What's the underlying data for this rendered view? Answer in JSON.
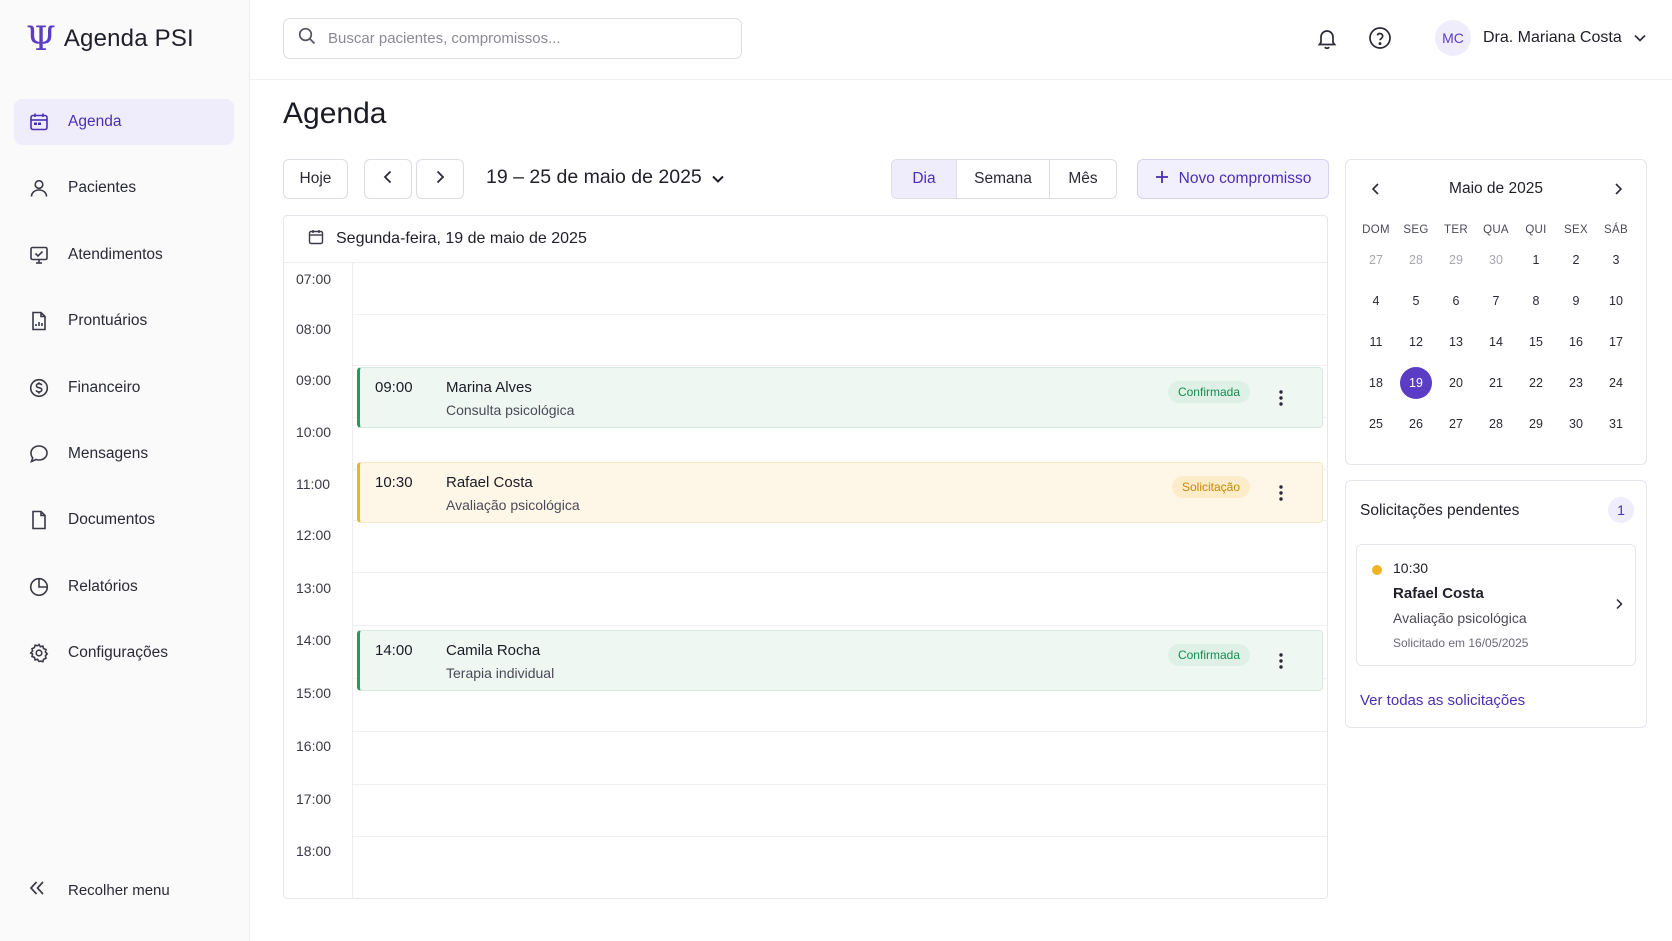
{
  "app": {
    "name": "Agenda PSI",
    "logo_glyph": "Ψ",
    "accent": "#5b3cc4"
  },
  "sidebar": {
    "items": [
      {
        "label": "Agenda",
        "icon": "calendar-icon",
        "active": true
      },
      {
        "label": "Pacientes",
        "icon": "user-icon"
      },
      {
        "label": "Atendimentos",
        "icon": "monitor-check-icon"
      },
      {
        "label": "Prontuários",
        "icon": "file-chart-icon"
      },
      {
        "label": "Financeiro",
        "icon": "dollar-circle-icon"
      },
      {
        "label": "Mensagens",
        "icon": "chat-bubble-icon"
      },
      {
        "label": "Documentos",
        "icon": "document-icon"
      },
      {
        "label": "Relatórios",
        "icon": "pie-chart-icon"
      },
      {
        "label": "Configurações",
        "icon": "gear-icon"
      }
    ],
    "collapse_label": "Recolher menu"
  },
  "topbar": {
    "search_placeholder": "Buscar pacientes, compromissos...",
    "user": {
      "initials": "MC",
      "name": "Dra. Mariana Costa"
    }
  },
  "page": {
    "title": "Agenda"
  },
  "toolbar": {
    "today_label": "Hoje",
    "range_label": "19 – 25 de maio de 2025",
    "views": [
      "Dia",
      "Semana",
      "Mês"
    ],
    "active_view": "Dia",
    "new_label": "Novo compromisso"
  },
  "day_view": {
    "date_label": "Segunda-feira, 19 de maio de 2025",
    "hours": [
      "07:00",
      "08:00",
      "09:00",
      "10:00",
      "11:00",
      "12:00",
      "13:00",
      "14:00",
      "15:00",
      "16:00",
      "17:00",
      "18:00"
    ],
    "events": [
      {
        "time": "09:00",
        "name": "Marina Alves",
        "type": "Consulta psicológica",
        "status": "Confirmada",
        "kind": "ok"
      },
      {
        "time": "10:30",
        "name": "Rafael Costa",
        "type": "Avaliação psicológica",
        "status": "Solicitação",
        "kind": "req"
      },
      {
        "time": "14:00",
        "name": "Camila Rocha",
        "type": "Terapia individual",
        "status": "Confirmada",
        "kind": "ok"
      }
    ]
  },
  "mini_calendar": {
    "title": "Maio de 2025",
    "weekdays": [
      "DOM",
      "SEG",
      "TER",
      "QUA",
      "QUI",
      "SEX",
      "SÁB"
    ],
    "weeks": [
      [
        "27",
        "28",
        "29",
        "30",
        "1",
        "2",
        "3"
      ],
      [
        "4",
        "5",
        "6",
        "7",
        "8",
        "9",
        "10"
      ],
      [
        "11",
        "12",
        "13",
        "14",
        "15",
        "16",
        "17"
      ],
      [
        "18",
        "19",
        "20",
        "21",
        "22",
        "23",
        "24"
      ],
      [
        "25",
        "26",
        "27",
        "28",
        "29",
        "30",
        "31"
      ]
    ],
    "selected": "19"
  },
  "pending": {
    "title": "Solicitações pendentes",
    "count": "1",
    "item": {
      "time": "10:30",
      "name": "Rafael Costa",
      "type": "Avaliação psicológica",
      "requested": "Solicitado em 16/05/2025"
    },
    "link_label": "Ver todas as solicitações"
  }
}
